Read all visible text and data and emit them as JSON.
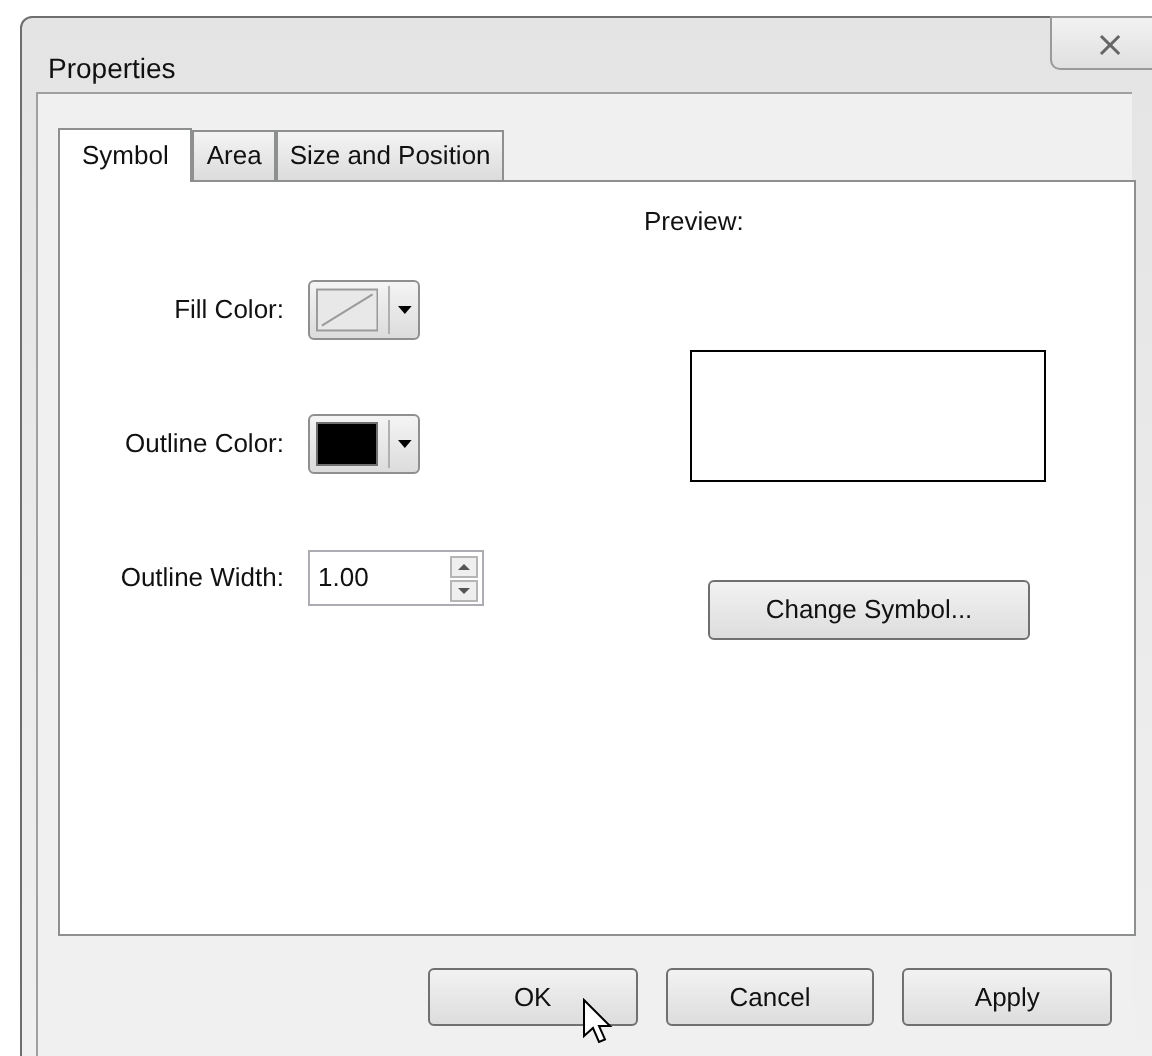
{
  "window": {
    "title": "Properties",
    "close": "⨯"
  },
  "tabs": [
    {
      "label": "Symbol",
      "selected": true
    },
    {
      "label": "Area",
      "selected": false
    },
    {
      "label": "Size and Position",
      "selected": false
    }
  ],
  "fields": [
    {
      "label": "Fill Color:",
      "kind": "no-color"
    },
    {
      "label": "Outline Color:",
      "kind": "color",
      "color": "#000000"
    },
    {
      "label": "Outline Width:",
      "kind": "spinner",
      "value": "1.00"
    }
  ],
  "preview": {
    "label": "Preview:"
  },
  "change_symbol_button": "Change Symbol...",
  "buttons": [
    "OK",
    "Cancel",
    "Apply"
  ]
}
